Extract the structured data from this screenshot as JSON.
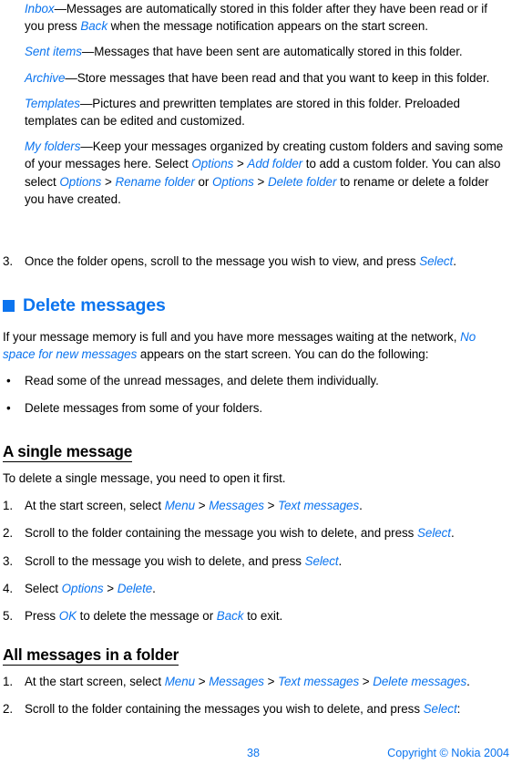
{
  "document": {
    "type": "user-guide-page",
    "accent_color": "#0b74ef",
    "text_color": "#000000",
    "background_color": "#ffffff"
  },
  "definitions": [
    {
      "term": "Inbox",
      "dash": "—",
      "text_1": "Messages are automatically stored in this folder after they have been read or if you press ",
      "term_2": "Back",
      "text_2": " when the message notification appears on the start screen."
    },
    {
      "term": "Sent items",
      "dash": "—",
      "text_1": "Messages that have been sent are automatically stored in this folder."
    },
    {
      "term": "Archive",
      "dash": "—",
      "text_1": "Store messages that have been read and that you want to keep in this folder."
    },
    {
      "term": "Templates",
      "dash": "—",
      "text_1": "Pictures and prewritten templates are stored in this folder. Preloaded templates can be edited and customized."
    }
  ],
  "my_folders": {
    "term": "My folders",
    "dash": "—",
    "t1": "Keep your messages organized by creating custom folders and saving some of your messages here. Select ",
    "ui1": "Options",
    "sep1": " > ",
    "ui2": "Add folder",
    "t2": " to add a custom folder. You can also select ",
    "ui3": "Options",
    "sep2": " > ",
    "ui4": "Rename folder",
    "t3": " or ",
    "ui5": "Options",
    "sep3": " > ",
    "ui6": "Delete folder",
    "t4": " to rename or delete a folder you have created."
  },
  "step_3_view": {
    "marker": "3.",
    "t1": "Once the folder opens, scroll to the message you wish to view, and press ",
    "ui1": "Select",
    "t2": "."
  },
  "heading_delete_messages": {
    "label": "Delete messages",
    "bullet_shape": "filled-square",
    "bullet_color": "#0b74ef"
  },
  "intro_paragraph": {
    "t1": "If your message memory is full and you have more messages waiting at the network, ",
    "ui1": "No space for new messages",
    "t2": " appears on the start screen. You can do the following:"
  },
  "bullets": [
    {
      "dot": "•",
      "text": "Read some of the unread messages, and delete them individually."
    },
    {
      "dot": "•",
      "text": "Delete messages from some of your folders."
    }
  ],
  "section_single": {
    "heading": "A single message",
    "lead": "To delete a single message, you need to open it first.",
    "steps": [
      {
        "marker": "1.",
        "t1": "At the start screen, select ",
        "ui1": "Menu",
        "sep1": " > ",
        "ui2": "Messages",
        "sep2": " > ",
        "ui3": "Text messages",
        "t2": "."
      },
      {
        "marker": "2.",
        "t1": "Scroll to the folder containing the message you wish to delete, and press ",
        "ui1": "Select",
        "t2": "."
      },
      {
        "marker": "3.",
        "t1": "Scroll to the message you wish to delete, and press ",
        "ui1": "Select",
        "t2": "."
      },
      {
        "marker": "4.",
        "t1": "Select ",
        "ui1": "Options",
        "sep1": " > ",
        "ui2": "Delete",
        "t2": "."
      },
      {
        "marker": "5.",
        "t1": "Press ",
        "ui1": "OK",
        "t2": " to delete the message or ",
        "ui2": "Back",
        "t3": " to exit."
      }
    ]
  },
  "section_folder": {
    "heading": "All messages in a folder",
    "steps": [
      {
        "marker": "1.",
        "t1": "At the start screen, select ",
        "ui1": "Menu",
        "sep1": " > ",
        "ui2": "Messages",
        "sep2": " > ",
        "ui3": "Text messages",
        "sep3": " > ",
        "ui4": "Delete messages",
        "t2": "."
      },
      {
        "marker": "2.",
        "t1": "Scroll to the folder containing the messages you wish to delete, and press ",
        "ui1": "Select",
        "t2": ":"
      }
    ]
  },
  "footer": {
    "page_number": "38",
    "copyright": "Copyright © Nokia 2004"
  }
}
